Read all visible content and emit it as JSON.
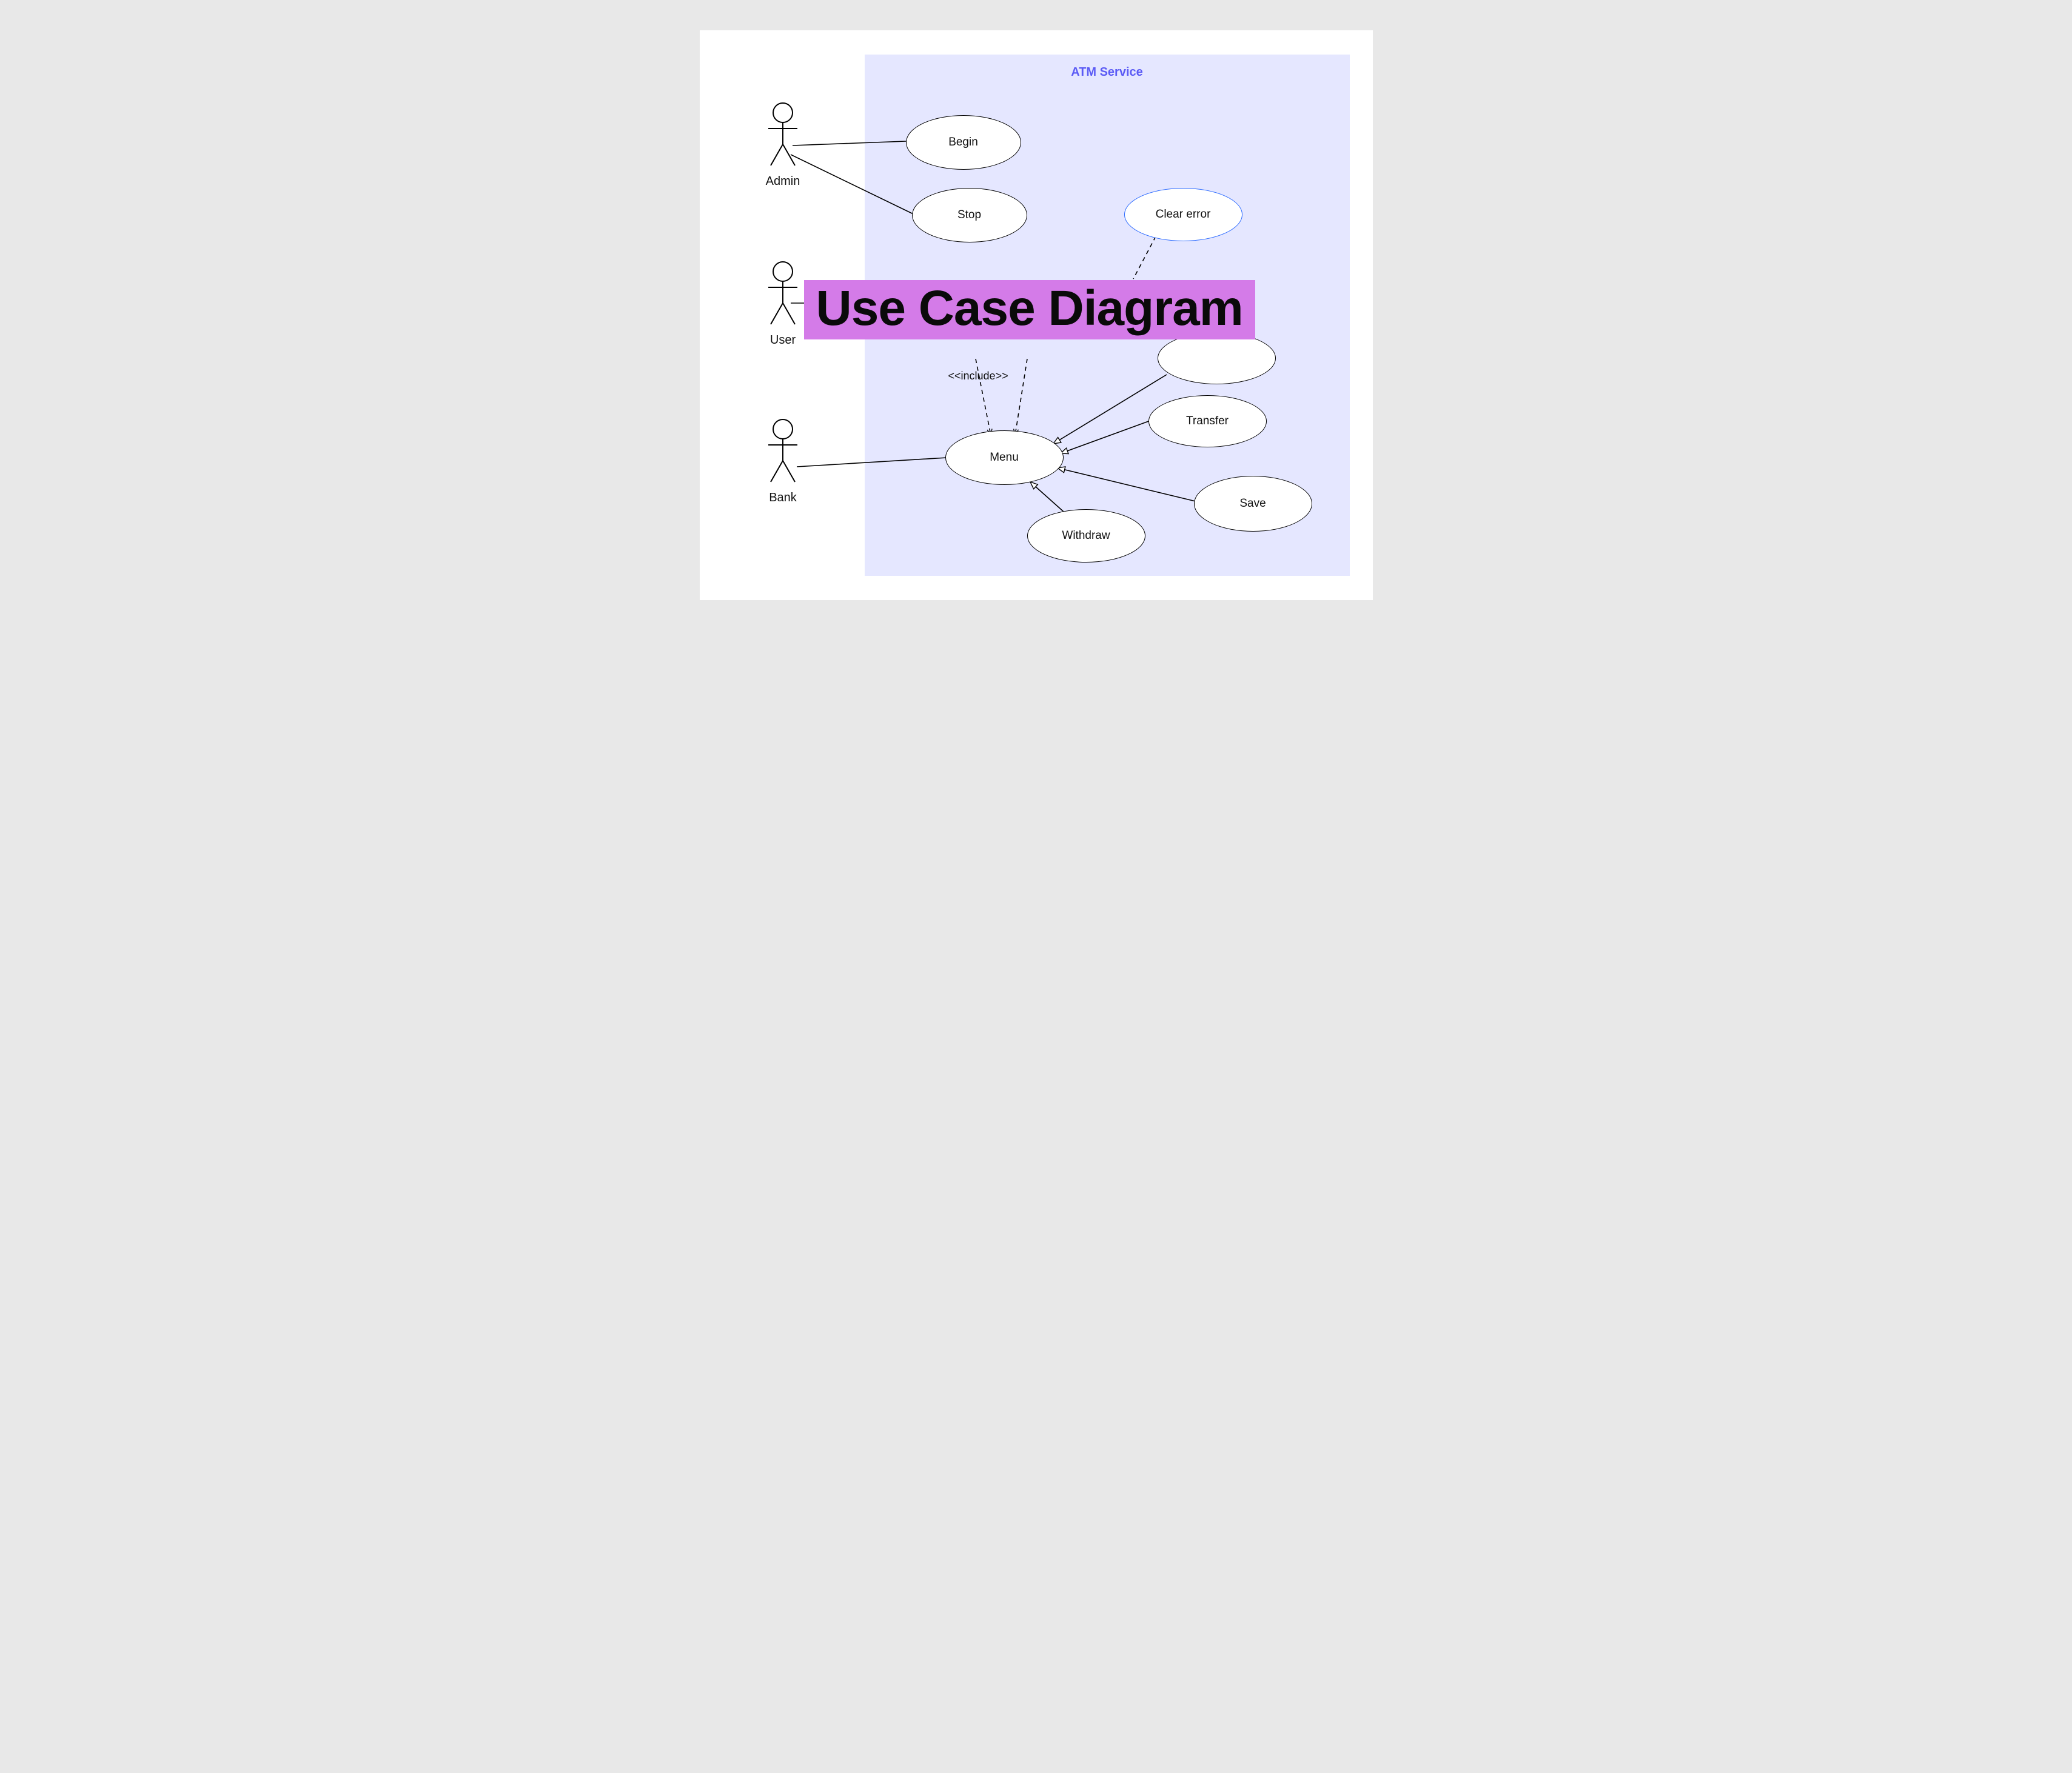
{
  "system": {
    "title": "ATM Service"
  },
  "actors": {
    "admin": {
      "label": "Admin"
    },
    "user": {
      "label": "User"
    },
    "bank": {
      "label": "Bank"
    }
  },
  "usecases": {
    "begin": {
      "label": "Begin"
    },
    "stop": {
      "label": "Stop"
    },
    "clear_error": {
      "label": "Clear error"
    },
    "menu": {
      "label": "Menu"
    },
    "transfer": {
      "label": "Transfer"
    },
    "save": {
      "label": "Save"
    },
    "withdraw": {
      "label": "Withdraw"
    }
  },
  "edges": {
    "include_label": "<<include>>"
  },
  "banner": {
    "text": "Use Case Diagram"
  }
}
